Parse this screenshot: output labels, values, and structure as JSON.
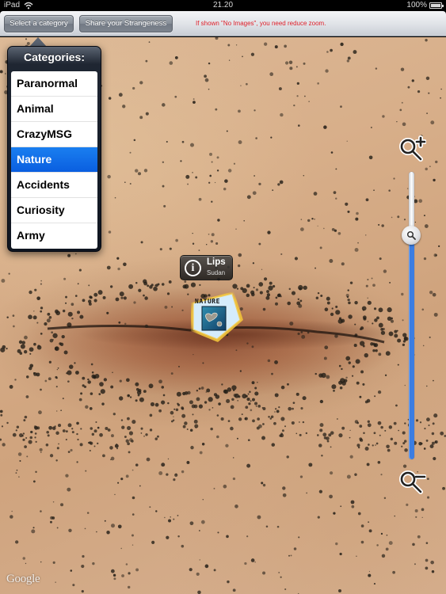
{
  "status_bar": {
    "device": "iPad",
    "time": "21.20",
    "battery": "100%"
  },
  "toolbar": {
    "select_category_label": "Select a category",
    "share_label": "Share your Strangeness",
    "notice": "If shown \"No Images\", you need reduce zoom."
  },
  "categories_popover": {
    "title": "Categories:",
    "items": [
      {
        "label": "Paranormal",
        "selected": false
      },
      {
        "label": "Animal",
        "selected": false
      },
      {
        "label": "CrazyMSG",
        "selected": false
      },
      {
        "label": "Nature",
        "selected": true
      },
      {
        "label": "Accidents",
        "selected": false
      },
      {
        "label": "Curiosity",
        "selected": false
      },
      {
        "label": "Army",
        "selected": false
      }
    ]
  },
  "map": {
    "attribution": "Google",
    "annotation": {
      "title": "Lips",
      "subtitle": "Sudan",
      "info_icon": "info-icon"
    },
    "pin": {
      "category_label": "NATURE",
      "icon": "heart-island-thumbnail"
    },
    "zoom_control": {
      "zoom_in_icon": "zoom-in-icon",
      "zoom_out_icon": "zoom-out-icon",
      "level_fraction": 0.78
    }
  },
  "colors": {
    "accent_blue": "#0a5ee0",
    "slider_blue": "#3b7de2",
    "notice_red": "#e0202a"
  }
}
